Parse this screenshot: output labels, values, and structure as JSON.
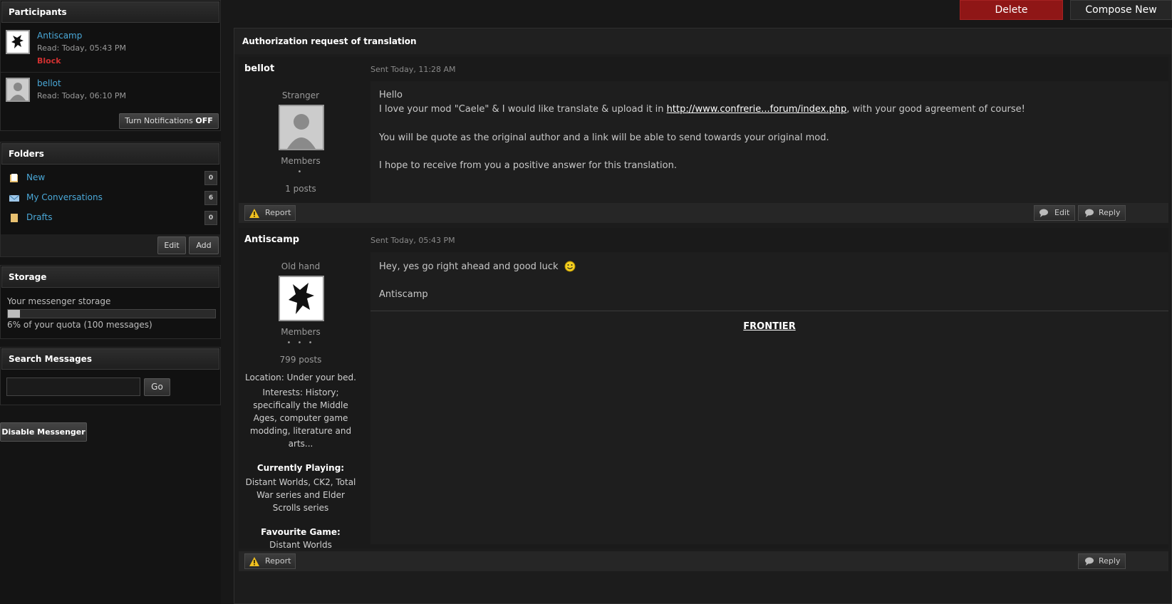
{
  "participants": {
    "title": "Participants",
    "items": [
      {
        "name": "Antiscamp",
        "read": "Read: Today, 05:43 PM",
        "block": "Block"
      },
      {
        "name": "bellot",
        "read": "Read: Today, 06:10 PM"
      }
    ],
    "notifications_label": "Turn Notifications",
    "notifications_state": "OFF"
  },
  "folders": {
    "title": "Folders",
    "items": [
      {
        "label": "New",
        "count": "0",
        "icon": "folder-new-icon"
      },
      {
        "label": "My Conversations",
        "count": "6",
        "icon": "envelope-icon"
      },
      {
        "label": "Drafts",
        "count": "0",
        "icon": "drafts-icon"
      }
    ],
    "edit_label": "Edit",
    "add_label": "Add"
  },
  "storage": {
    "title": "Storage",
    "label": "Your messenger storage",
    "quota_text": "6% of your quota (100 messages)",
    "percent": 6
  },
  "search": {
    "title": "Search Messages",
    "placeholder": "",
    "go_label": "Go"
  },
  "disable_label": "Disable Messenger",
  "toolbar": {
    "delete_label": "Delete",
    "compose_label": "Compose New"
  },
  "conversation": {
    "title": "Authorization request of translation",
    "posts": [
      {
        "author": "bellot",
        "date": "Sent Today, 11:28 AM",
        "rank": "Stranger",
        "group": "Members",
        "pips": "•",
        "posts": "1 posts",
        "body": {
          "line1": "Hello",
          "line2_pre": "I love your mod \"Caele\" & I would like translate & upload it in ",
          "link": "http://www.confrerie...forum/index.php",
          "line2_post": ", with your good agreement of course!",
          "line3": "You will be quote as the original author and a link will be able to send towards your original mod.",
          "line4": "I hope to receive from you a positive answer for this translation."
        },
        "report_label": "Report",
        "edit_label": "Edit",
        "reply_label": "Reply"
      },
      {
        "author": "Antiscamp",
        "date": "Sent Today, 05:43 PM",
        "rank": "Old hand",
        "group": "Members",
        "pips": "• • •",
        "posts": "799 posts",
        "profile": {
          "location": "Location: Under your bed.",
          "interests": "Interests: History; specifically the Middle Ages, computer game modding, literature and arts...",
          "playing_label": "Currently Playing:",
          "playing": "Distant Worlds, CK2, Total War series and Elder Scrolls series",
          "fav_label": "Favourite Game:",
          "fav": "Distant Worlds"
        },
        "body": {
          "line1": "Hey, yes go right ahead and good luck",
          "line2": "Antiscamp",
          "signature": "FRONTIER"
        },
        "report_label": "Report",
        "reply_label": "Reply"
      }
    ]
  }
}
